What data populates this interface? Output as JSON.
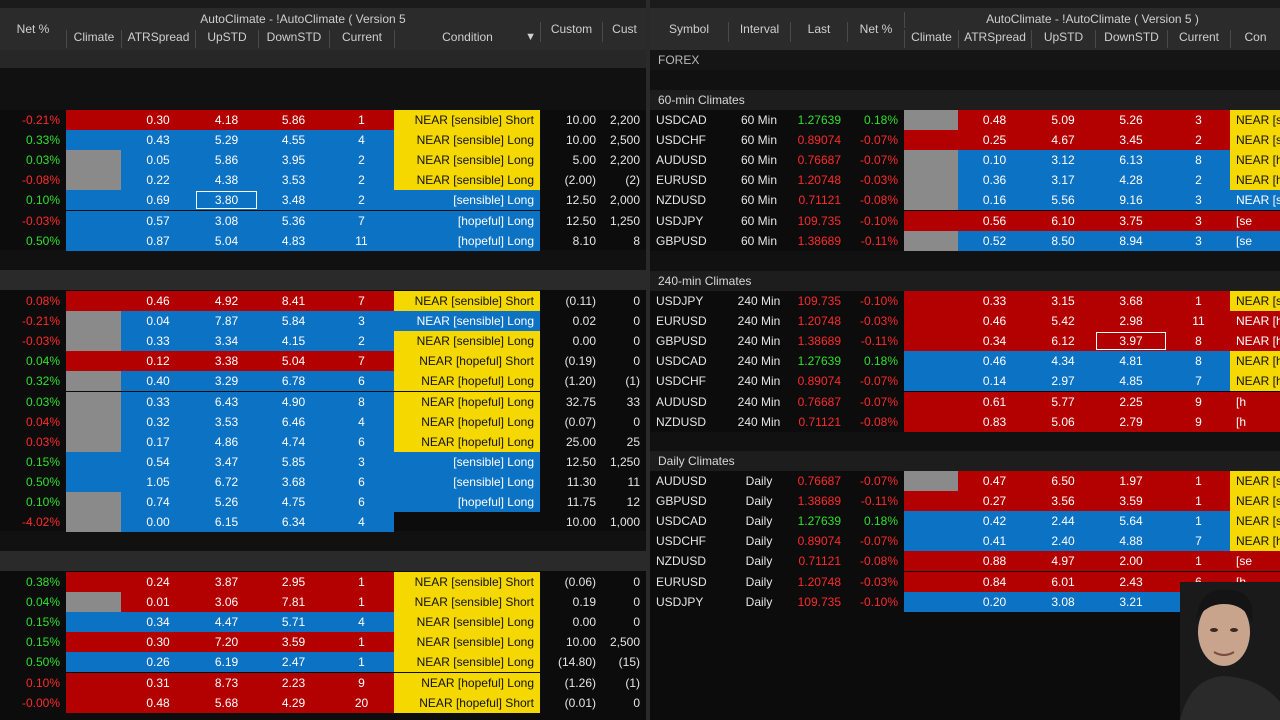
{
  "left": {
    "headers": {
      "net": "Net %",
      "group_title": "AutoClimate - !AutoClimate ( Version 5",
      "climate": "Climate",
      "atr": "ATRSpread",
      "up": "UpSTD",
      "down": "DownSTD",
      "current": "Current",
      "condition": "Condition",
      "custom": "Custom",
      "cust2": "Cust"
    },
    "groups": [
      {
        "rows": [
          {
            "net": "-0.21%",
            "netc": "neg",
            "climate": "red",
            "atr": "0.30",
            "up": "4.18",
            "down": "5.86",
            "cur": "1",
            "rowc": "red",
            "cond": "NEAR [sensible] Short",
            "condc": "yellow",
            "cust": "10.00",
            "cust2": "2,200"
          },
          {
            "net": "0.33%",
            "netc": "pos",
            "climate": "blue",
            "atr": "0.43",
            "up": "5.29",
            "down": "4.55",
            "cur": "4",
            "rowc": "blue",
            "cond": "NEAR [sensible] Long",
            "condc": "yellow",
            "cust": "10.00",
            "cust2": "2,500"
          },
          {
            "net": "0.03%",
            "netc": "pos",
            "climate": "gray",
            "atr": "0.05",
            "up": "5.86",
            "down": "3.95",
            "cur": "2",
            "rowc": "blue",
            "cond": "NEAR [sensible] Long",
            "condc": "yellow",
            "cust": "5.00",
            "cust2": "2,200"
          },
          {
            "net": "-0.08%",
            "netc": "neg",
            "climate": "gray",
            "atr": "0.22",
            "up": "4.38",
            "down": "3.53",
            "cur": "2",
            "rowc": "blue",
            "cond": "NEAR [sensible] Long",
            "condc": "yellow",
            "cust": "(2.00)",
            "cust2": "(2)"
          },
          {
            "net": "0.10%",
            "netc": "pos",
            "climate": "blue",
            "atr": "0.69",
            "up": "3.80",
            "down": "3.48",
            "cur": "2",
            "rowc": "blue",
            "cond": "[sensible] Long",
            "condc": "blue",
            "cust": "12.50",
            "cust2": "2,000",
            "sel": true
          },
          {
            "net": "-0.03%",
            "netc": "neg",
            "climate": "blue",
            "atr": "0.57",
            "up": "3.08",
            "down": "5.36",
            "cur": "7",
            "rowc": "blue",
            "cond": "[hopeful] Long",
            "condc": "blue",
            "cust": "12.50",
            "cust2": "1,250"
          },
          {
            "net": "0.50%",
            "netc": "pos",
            "climate": "blue",
            "atr": "0.87",
            "up": "5.04",
            "down": "4.83",
            "cur": "11",
            "rowc": "blue",
            "cond": "[hopeful] Long",
            "condc": "blue",
            "cust": "8.10",
            "cust2": "8"
          }
        ]
      },
      {
        "rows": [
          {
            "net": "0.08%",
            "netc": "neg",
            "climate": "red",
            "atr": "0.46",
            "up": "4.92",
            "down": "8.41",
            "cur": "7",
            "rowc": "red",
            "cond": "NEAR [sensible] Short",
            "condc": "yellow",
            "cust": "(0.11)",
            "cust2": "0"
          },
          {
            "net": "-0.21%",
            "netc": "neg",
            "climate": "gray",
            "atr": "0.04",
            "up": "7.87",
            "down": "5.84",
            "cur": "3",
            "rowc": "blue",
            "cond": "NEAR [sensible] Long",
            "condc": "blue",
            "cust": "0.02",
            "cust2": "0"
          },
          {
            "net": "-0.03%",
            "netc": "neg",
            "climate": "gray",
            "atr": "0.33",
            "up": "3.34",
            "down": "4.15",
            "cur": "2",
            "rowc": "blue",
            "cond": "NEAR [sensible] Long",
            "condc": "yellow",
            "cust": "0.00",
            "cust2": "0"
          },
          {
            "net": "0.04%",
            "netc": "pos",
            "climate": "red",
            "atr": "0.12",
            "up": "3.38",
            "down": "5.04",
            "cur": "7",
            "rowc": "red",
            "cond": "NEAR [hopeful] Short",
            "condc": "yellow",
            "cust": "(0.19)",
            "cust2": "0"
          },
          {
            "net": "0.32%",
            "netc": "pos",
            "climate": "gray",
            "atr": "0.40",
            "up": "3.29",
            "down": "6.78",
            "cur": "6",
            "rowc": "blue",
            "cond": "NEAR [hopeful] Long",
            "condc": "yellow",
            "cust": "(1.20)",
            "cust2": "(1)"
          },
          {
            "net": "0.03%",
            "netc": "pos",
            "climate": "gray",
            "atr": "0.33",
            "up": "6.43",
            "down": "4.90",
            "cur": "8",
            "rowc": "blue",
            "cond": "NEAR [hopeful] Long",
            "condc": "yellow",
            "cust": "32.75",
            "cust2": "33"
          },
          {
            "net": "0.04%",
            "netc": "neg",
            "climate": "gray",
            "atr": "0.32",
            "up": "3.53",
            "down": "6.46",
            "cur": "4",
            "rowc": "blue",
            "cond": "NEAR [hopeful] Long",
            "condc": "yellow",
            "cust": "(0.07)",
            "cust2": "0"
          },
          {
            "net": "0.03%",
            "netc": "neg",
            "climate": "gray",
            "atr": "0.17",
            "up": "4.86",
            "down": "4.74",
            "cur": "6",
            "rowc": "blue",
            "cond": "NEAR [hopeful] Long",
            "condc": "yellow",
            "cust": "25.00",
            "cust2": "25"
          },
          {
            "net": "0.15%",
            "netc": "pos",
            "climate": "blue",
            "atr": "0.54",
            "up": "3.47",
            "down": "5.85",
            "cur": "3",
            "rowc": "blue",
            "cond": "[sensible] Long",
            "condc": "blue",
            "cust": "12.50",
            "cust2": "1,250"
          },
          {
            "net": "0.50%",
            "netc": "pos",
            "climate": "blue",
            "atr": "1.05",
            "up": "6.72",
            "down": "3.68",
            "cur": "6",
            "rowc": "blue",
            "cond": "[sensible] Long",
            "condc": "blue",
            "cust": "11.30",
            "cust2": "11"
          },
          {
            "net": "0.10%",
            "netc": "pos",
            "climate": "gray",
            "atr": "0.74",
            "up": "5.26",
            "down": "4.75",
            "cur": "6",
            "rowc": "blue",
            "cond": "[hopeful] Long",
            "condc": "blue",
            "cust": "11.75",
            "cust2": "12"
          },
          {
            "net": "-4.02%",
            "netc": "neg",
            "climate": "gray",
            "atr": "0.00",
            "up": "6.15",
            "down": "6.34",
            "cur": "4",
            "rowc": "blue",
            "cond": "",
            "condc": "dark",
            "cust": "10.00",
            "cust2": "1,000"
          }
        ]
      },
      {
        "rows": [
          {
            "net": "0.38%",
            "netc": "pos",
            "climate": "red",
            "atr": "0.24",
            "up": "3.87",
            "down": "2.95",
            "cur": "1",
            "rowc": "red",
            "cond": "NEAR [sensible] Short",
            "condc": "yellow",
            "cust": "(0.06)",
            "cust2": "0"
          },
          {
            "net": "0.04%",
            "netc": "pos",
            "climate": "gray",
            "atr": "0.01",
            "up": "3.06",
            "down": "7.81",
            "cur": "1",
            "rowc": "red",
            "cond": "NEAR [sensible] Short",
            "condc": "yellow",
            "cust": "0.19",
            "cust2": "0"
          },
          {
            "net": "0.15%",
            "netc": "pos",
            "climate": "blue",
            "atr": "0.34",
            "up": "4.47",
            "down": "5.71",
            "cur": "4",
            "rowc": "blue",
            "cond": "NEAR [sensible] Long",
            "condc": "yellow",
            "cust": "0.00",
            "cust2": "0"
          },
          {
            "net": "0.15%",
            "netc": "pos",
            "climate": "red",
            "atr": "0.30",
            "up": "7.20",
            "down": "3.59",
            "cur": "1",
            "rowc": "red",
            "cond": "NEAR [sensible] Long",
            "condc": "yellow",
            "cust": "10.00",
            "cust2": "2,500"
          },
          {
            "net": "0.50%",
            "netc": "pos",
            "climate": "blue",
            "atr": "0.26",
            "up": "6.19",
            "down": "2.47",
            "cur": "1",
            "rowc": "blue",
            "cond": "NEAR [sensible] Long",
            "condc": "yellow",
            "cust": "(14.80)",
            "cust2": "(15)"
          },
          {
            "net": "0.10%",
            "netc": "neg",
            "climate": "red",
            "atr": "0.31",
            "up": "8.73",
            "down": "2.23",
            "cur": "9",
            "rowc": "red",
            "cond": "NEAR [hopeful] Long",
            "condc": "yellow",
            "cust": "(1.26)",
            "cust2": "(1)"
          },
          {
            "net": "-0.00%",
            "netc": "neg",
            "climate": "red",
            "atr": "0.48",
            "up": "5.68",
            "down": "4.29",
            "cur": "20",
            "rowc": "red",
            "cond": "NEAR [hopeful] Short",
            "condc": "yellow",
            "cust": "(0.01)",
            "cust2": "0"
          }
        ]
      }
    ]
  },
  "right": {
    "headers": {
      "symbol": "Symbol",
      "interval": "Interval",
      "last": "Last",
      "net": "Net %",
      "group_title": "AutoClimate - !AutoClimate ( Version 5 )",
      "climate": "Climate",
      "atr": "ATRSpread",
      "up": "UpSTD",
      "down": "DownSTD",
      "current": "Current",
      "cond": "Con"
    },
    "forex_label": "FOREX",
    "sections": [
      {
        "title": "60-min Climates",
        "rows": [
          {
            "sym": "USDCAD",
            "int": "60 Min",
            "last": "1.27639",
            "lastc": "pos",
            "net": "0.18%",
            "netc": "pos",
            "climate": "gray",
            "atr": "0.48",
            "up": "5.09",
            "down": "5.26",
            "cur": "3",
            "rowc": "red",
            "cond": "NEAR [se",
            "condc": "yellow"
          },
          {
            "sym": "USDCHF",
            "int": "60 Min",
            "last": "0.89074",
            "lastc": "neg",
            "net": "-0.07%",
            "netc": "neg",
            "climate": "red",
            "atr": "0.25",
            "up": "4.67",
            "down": "3.45",
            "cur": "2",
            "rowc": "red",
            "cond": "NEAR [se",
            "condc": "yellow"
          },
          {
            "sym": "AUDUSD",
            "int": "60 Min",
            "last": "0.76687",
            "lastc": "neg",
            "net": "-0.07%",
            "netc": "neg",
            "climate": "gray",
            "atr": "0.10",
            "up": "3.12",
            "down": "6.13",
            "cur": "8",
            "rowc": "blue",
            "cond": "NEAR [ho",
            "condc": "yellow"
          },
          {
            "sym": "EURUSD",
            "int": "60 Min",
            "last": "1.20748",
            "lastc": "neg",
            "net": "-0.03%",
            "netc": "neg",
            "climate": "gray",
            "atr": "0.36",
            "up": "3.17",
            "down": "4.28",
            "cur": "2",
            "rowc": "blue",
            "cond": "NEAR [ho",
            "condc": "yellow"
          },
          {
            "sym": "NZDUSD",
            "int": "60 Min",
            "last": "0.71121",
            "lastc": "neg",
            "net": "-0.08%",
            "netc": "neg",
            "climate": "gray",
            "atr": "0.16",
            "up": "5.56",
            "down": "9.16",
            "cur": "3",
            "rowc": "blue",
            "cond": "NEAR [se",
            "condc": "blue"
          },
          {
            "sym": "USDJPY",
            "int": "60 Min",
            "last": "109.735",
            "lastc": "neg",
            "net": "-0.10%",
            "netc": "neg",
            "climate": "red",
            "atr": "0.56",
            "up": "6.10",
            "down": "3.75",
            "cur": "3",
            "rowc": "red",
            "cond": "[se",
            "condc": "red"
          },
          {
            "sym": "GBPUSD",
            "int": "60 Min",
            "last": "1.38689",
            "lastc": "neg",
            "net": "-0.11%",
            "netc": "neg",
            "climate": "gray",
            "atr": "0.52",
            "up": "8.50",
            "down": "8.94",
            "cur": "3",
            "rowc": "blue",
            "cond": "[se",
            "condc": "blue"
          }
        ]
      },
      {
        "title": "240-min Climates",
        "rows": [
          {
            "sym": "USDJPY",
            "int": "240 Min",
            "last": "109.735",
            "lastc": "neg",
            "net": "-0.10%",
            "netc": "neg",
            "climate": "red",
            "atr": "0.33",
            "up": "3.15",
            "down": "3.68",
            "cur": "1",
            "rowc": "red",
            "cond": "NEAR [se",
            "condc": "yellow"
          },
          {
            "sym": "EURUSD",
            "int": "240 Min",
            "last": "1.20748",
            "lastc": "neg",
            "net": "-0.03%",
            "netc": "neg",
            "climate": "red",
            "atr": "0.46",
            "up": "5.42",
            "down": "2.98",
            "cur": "11",
            "rowc": "red",
            "cond": "NEAR [ho",
            "condc": "red"
          },
          {
            "sym": "GBPUSD",
            "int": "240 Min",
            "last": "1.38689",
            "lastc": "neg",
            "net": "-0.11%",
            "netc": "neg",
            "climate": "red",
            "atr": "0.34",
            "up": "6.12",
            "down": "3.97",
            "cur": "8",
            "rowc": "red",
            "cond": "NEAR [h",
            "condc": "red",
            "sel": true
          },
          {
            "sym": "USDCAD",
            "int": "240 Min",
            "last": "1.27639",
            "lastc": "pos",
            "net": "0.18%",
            "netc": "pos",
            "climate": "blue",
            "atr": "0.46",
            "up": "4.34",
            "down": "4.81",
            "cur": "8",
            "rowc": "blue",
            "cond": "NEAR [h",
            "condc": "yellow"
          },
          {
            "sym": "USDCHF",
            "int": "240 Min",
            "last": "0.89074",
            "lastc": "neg",
            "net": "-0.07%",
            "netc": "neg",
            "climate": "blue",
            "atr": "0.14",
            "up": "2.97",
            "down": "4.85",
            "cur": "7",
            "rowc": "blue",
            "cond": "NEAR [h",
            "condc": "yellow"
          },
          {
            "sym": "AUDUSD",
            "int": "240 Min",
            "last": "0.76687",
            "lastc": "neg",
            "net": "-0.07%",
            "netc": "neg",
            "climate": "red",
            "atr": "0.61",
            "up": "5.77",
            "down": "2.25",
            "cur": "9",
            "rowc": "red",
            "cond": "[h",
            "condc": "red"
          },
          {
            "sym": "NZDUSD",
            "int": "240 Min",
            "last": "0.71121",
            "lastc": "neg",
            "net": "-0.08%",
            "netc": "neg",
            "climate": "red",
            "atr": "0.83",
            "up": "5.06",
            "down": "2.79",
            "cur": "9",
            "rowc": "red",
            "cond": "[h",
            "condc": "red"
          }
        ]
      },
      {
        "title": "Daily Climates",
        "rows": [
          {
            "sym": "AUDUSD",
            "int": "Daily",
            "last": "0.76687",
            "lastc": "neg",
            "net": "-0.07%",
            "netc": "neg",
            "climate": "gray",
            "atr": "0.47",
            "up": "6.50",
            "down": "1.97",
            "cur": "1",
            "rowc": "red",
            "cond": "NEAR [se",
            "condc": "yellow"
          },
          {
            "sym": "GBPUSD",
            "int": "Daily",
            "last": "1.38689",
            "lastc": "neg",
            "net": "-0.11%",
            "netc": "neg",
            "climate": "red",
            "atr": "0.27",
            "up": "3.56",
            "down": "3.59",
            "cur": "1",
            "rowc": "red",
            "cond": "NEAR [se",
            "condc": "yellow"
          },
          {
            "sym": "USDCAD",
            "int": "Daily",
            "last": "1.27639",
            "lastc": "pos",
            "net": "0.18%",
            "netc": "pos",
            "climate": "blue",
            "atr": "0.42",
            "up": "2.44",
            "down": "5.64",
            "cur": "1",
            "rowc": "blue",
            "cond": "NEAR [se",
            "condc": "yellow"
          },
          {
            "sym": "USDCHF",
            "int": "Daily",
            "last": "0.89074",
            "lastc": "neg",
            "net": "-0.07%",
            "netc": "neg",
            "climate": "blue",
            "atr": "0.41",
            "up": "2.40",
            "down": "4.88",
            "cur": "7",
            "rowc": "blue",
            "cond": "NEAR [h",
            "condc": "yellow"
          },
          {
            "sym": "NZDUSD",
            "int": "Daily",
            "last": "0.71121",
            "lastc": "neg",
            "net": "-0.08%",
            "netc": "neg",
            "climate": "red",
            "atr": "0.88",
            "up": "4.97",
            "down": "2.00",
            "cur": "1",
            "rowc": "red",
            "cond": "[se",
            "condc": "red"
          },
          {
            "sym": "EURUSD",
            "int": "Daily",
            "last": "1.20748",
            "lastc": "neg",
            "net": "-0.03%",
            "netc": "neg",
            "climate": "red",
            "atr": "0.84",
            "up": "6.01",
            "down": "2.43",
            "cur": "6",
            "rowc": "red",
            "cond": "[h",
            "condc": "red"
          },
          {
            "sym": "USDJPY",
            "int": "Daily",
            "last": "109.735",
            "lastc": "neg",
            "net": "-0.10%",
            "netc": "neg",
            "climate": "blue",
            "atr": "0.20",
            "up": "3.08",
            "down": "3.21",
            "cur": "",
            "rowc": "blue",
            "cond": "",
            "condc": "dark"
          }
        ]
      }
    ]
  }
}
